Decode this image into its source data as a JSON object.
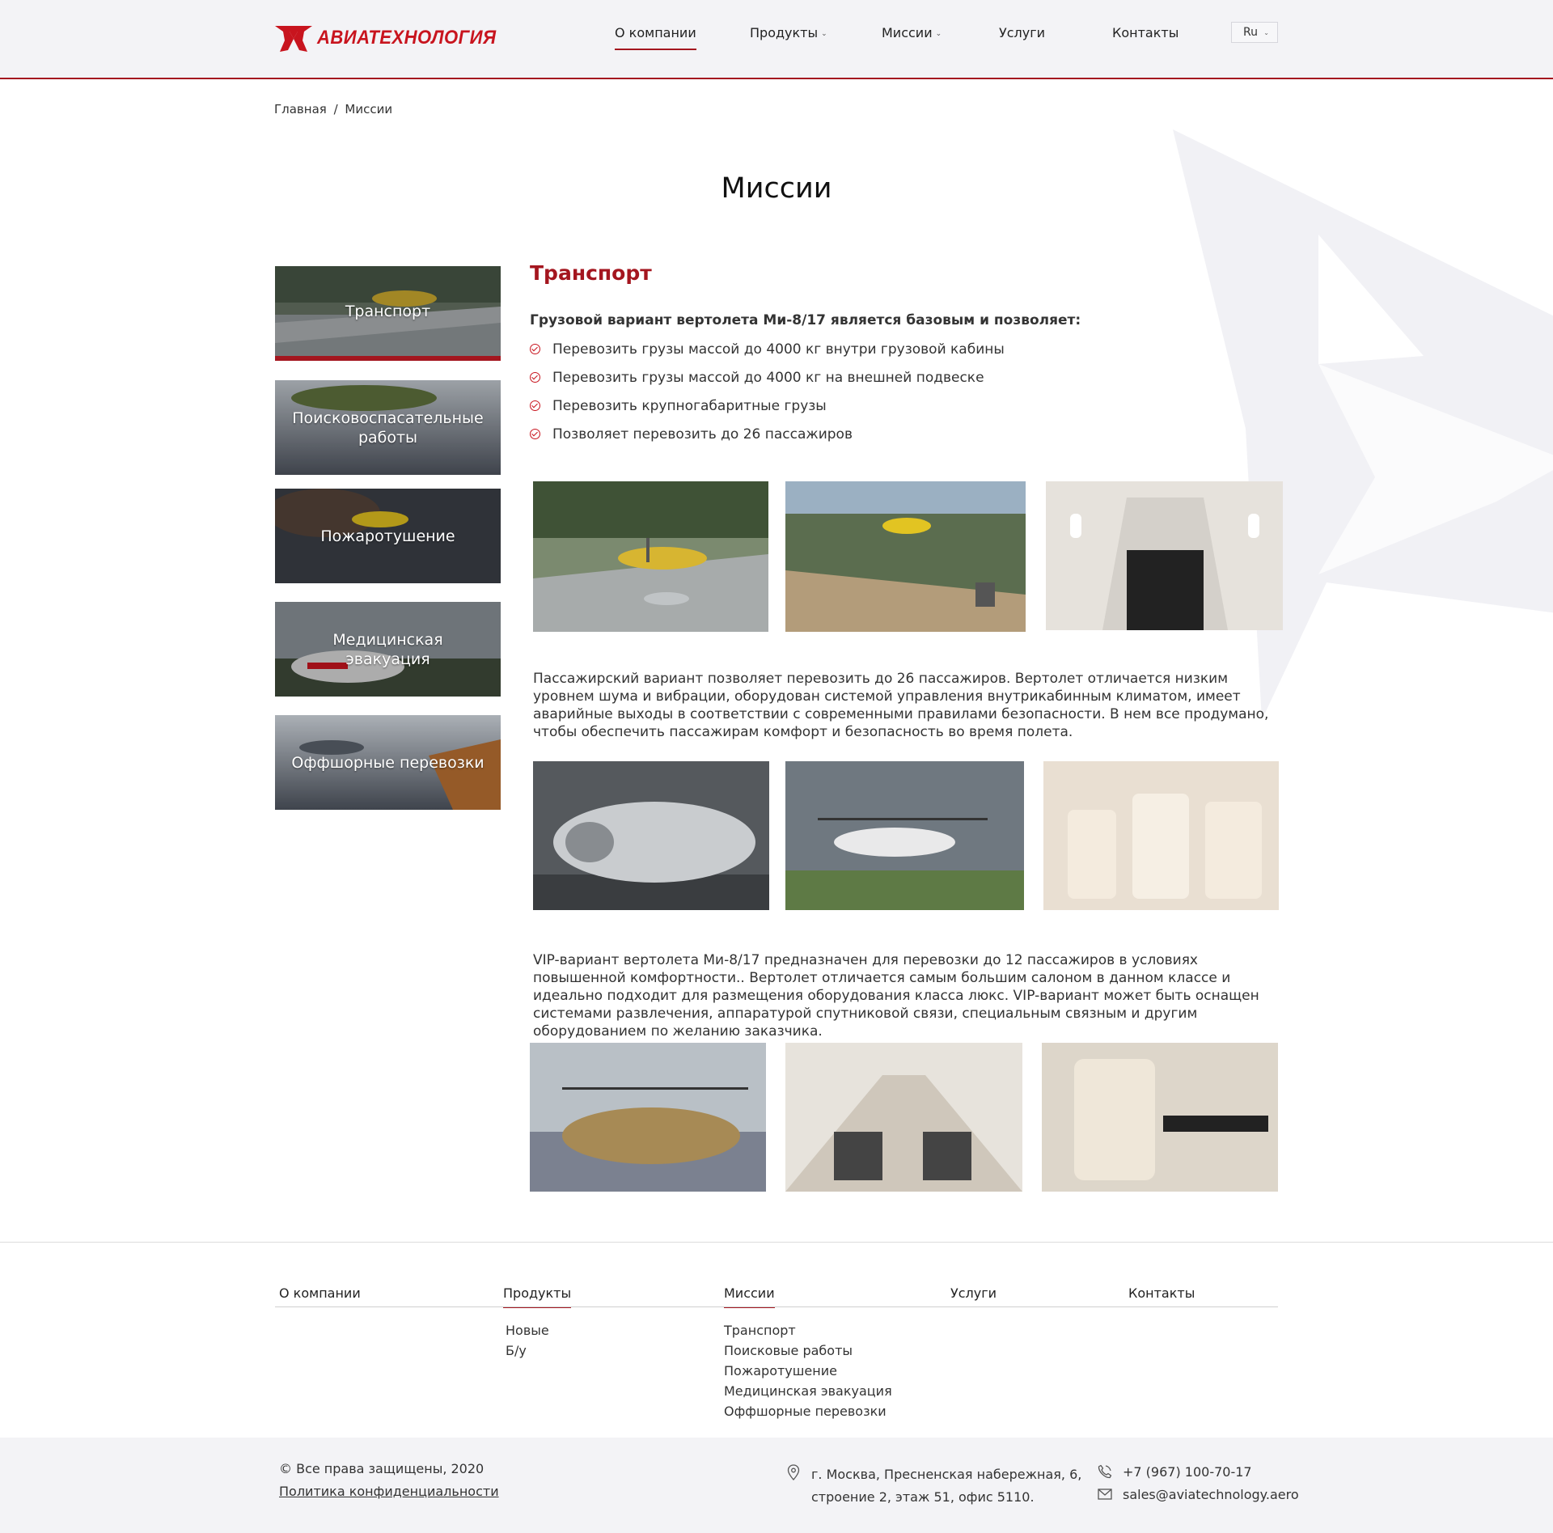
{
  "header": {
    "logo_text": "АВИАТЕХНОЛОГИЯ",
    "nav": [
      {
        "label": "О компании",
        "active": true
      },
      {
        "label": "Продукты",
        "dropdown": true
      },
      {
        "label": "Миссии",
        "dropdown": true
      },
      {
        "label": "Услуги"
      },
      {
        "label": "Контакты"
      }
    ],
    "lang": "Ru"
  },
  "breadcrumb": {
    "home": "Главная",
    "sep": "/",
    "current": "Миссии"
  },
  "page_title": "Миссии",
  "sidebar": [
    {
      "label": "Транспорт",
      "active": true
    },
    {
      "label": "Поисковоспасательные работы"
    },
    {
      "label": "Пожаротушение"
    },
    {
      "label": "Медицинская эвакуация"
    },
    {
      "label": "Оффшорные перевозки"
    }
  ],
  "content": {
    "title": "Транспорт",
    "lead": "Грузовой вариант вертолета Ми-8/17 является базовым и позволяет:",
    "bullets": [
      "Перевозить грузы массой до 4000 кг внутри грузовой кабины",
      "Перевозить грузы массой до 4000 кг на внешней подвеске",
      "Перевозить крупногабаритные грузы",
      "Позволяет перевозить до 26 пассажиров"
    ],
    "para_passenger": "Пассажирский вариант позволяет перевозить до 26 пассажиров. Вертолет отличается низким уровнем шума и вибрации, оборудован системой управления внутрикабинным климатом, имеет аварийные выходы в соответствии с современными правилами безопасности. В нем все продумано, чтобы обеспечить пассажирам комфорт и безопасность во время полета.",
    "para_vip": "VIP-вариант вертолета Ми-8/17 предназначен для перевозки до 12 пассажиров в условиях повышенной комфортности.. Вертолет отличается самым большим салоном в данном классе и идеально подходит для размещения оборудования класса люкс. VIP-вариант может быть оснащен системами развлечения, аппаратурой спутниковой связи, специальным связным и другим оборудованием по желанию заказчика."
  },
  "footer": {
    "nav": [
      {
        "label": "О компании"
      },
      {
        "label": "Продукты",
        "active": true
      },
      {
        "label": "Миссии",
        "active": true
      },
      {
        "label": "Услуги"
      },
      {
        "label": "Контакты"
      }
    ],
    "products": [
      "Новые",
      "Б/у"
    ],
    "missions": [
      "Транспорт",
      "Поисковые работы",
      "Пожаротушение",
      "Медицинская эвакуация",
      "Оффшорные перевозки"
    ],
    "copyright": "© Все права защищены, 2020",
    "policy": "Политика конфиденциальности",
    "address_line1": "г. Москва, Пресненская набережная, 6,",
    "address_line2": "строение 2, этаж 51, офис 5110.",
    "phone": "+7 (967) 100-70-17",
    "email": "sales@aviatechnology.aero"
  },
  "colors": {
    "brand": "#a4161f",
    "logo": "#c8141e",
    "header_bg": "#f3f3f6"
  }
}
